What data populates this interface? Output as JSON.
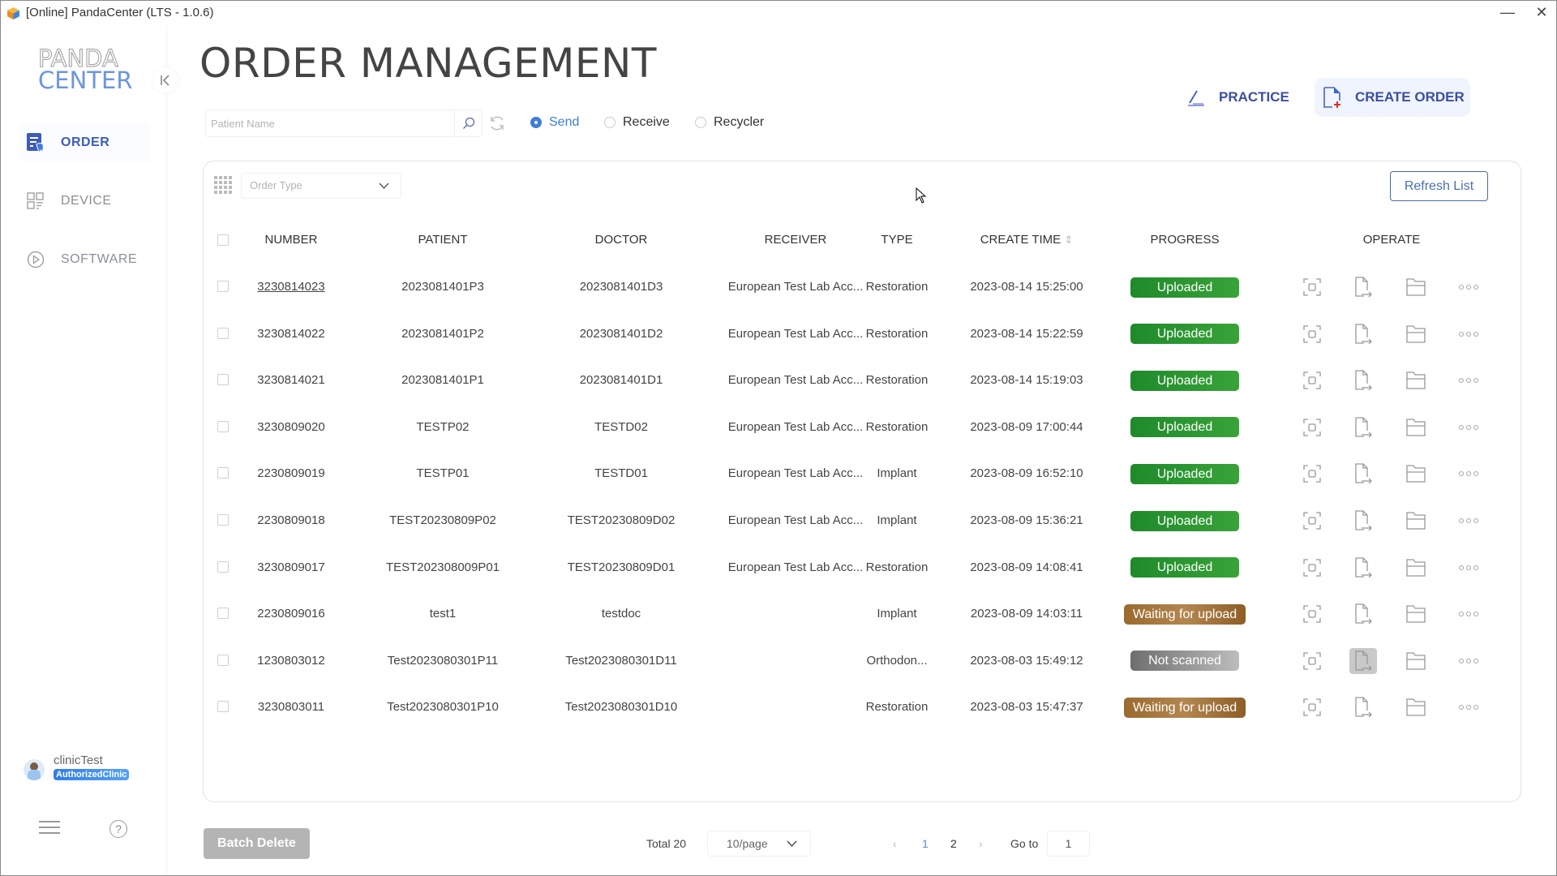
{
  "window": {
    "title": "[Online] PandaCenter (LTS - 1.0.6)",
    "minimize_glyph": "—",
    "close_glyph": "✕"
  },
  "sidebar": {
    "logo_top": "PANDA",
    "logo_bottom": "CENTER",
    "collapse_glyph": "|<",
    "items": [
      {
        "label": "ORDER",
        "icon": "order-tooth-icon",
        "active": true
      },
      {
        "label": "DEVICE",
        "icon": "device-grid-icon",
        "active": false
      },
      {
        "label": "SOFTWARE",
        "icon": "play-circle-icon",
        "active": false
      }
    ],
    "user": {
      "name": "clinicTest",
      "badge": "AuthorizedClinic"
    },
    "help_glyph": "?"
  },
  "header": {
    "title": "ORDER MANAGEMENT",
    "practice_label": "PRACTICE",
    "create_order_label": "CREATE ORDER"
  },
  "filters": {
    "search_placeholder": "Patient Name",
    "search_value": "",
    "radios": [
      {
        "label": "Send",
        "checked": true
      },
      {
        "label": "Receive",
        "checked": false
      },
      {
        "label": "Recycler",
        "checked": false
      }
    ],
    "order_type_placeholder": "Order Type",
    "refresh_label": "Refresh List"
  },
  "table": {
    "columns": [
      "NUMBER",
      "PATIENT",
      "DOCTOR",
      "RECEIVER",
      "TYPE",
      "CREATE TIME",
      "PROGRESS",
      "OPERATE"
    ],
    "sort_glyph": "⇕",
    "rows": [
      {
        "number": "3230814023",
        "patient": "2023081401P3",
        "doctor": "2023081401D3",
        "receiver": "European Test Lab Acc...",
        "type": "Restoration",
        "create_time": "2023-08-14 15:25:00",
        "progress": "Uploaded",
        "status": "uploaded"
      },
      {
        "number": "3230814022",
        "patient": "2023081401P2",
        "doctor": "2023081401D2",
        "receiver": "European Test Lab Acc...",
        "type": "Restoration",
        "create_time": "2023-08-14 15:22:59",
        "progress": "Uploaded",
        "status": "uploaded"
      },
      {
        "number": "3230814021",
        "patient": "2023081401P1",
        "doctor": "2023081401D1",
        "receiver": "European Test Lab Acc...",
        "type": "Restoration",
        "create_time": "2023-08-14 15:19:03",
        "progress": "Uploaded",
        "status": "uploaded"
      },
      {
        "number": "3230809020",
        "patient": "TESTP02",
        "doctor": "TESTD02",
        "receiver": "European Test Lab Acc...",
        "type": "Restoration",
        "create_time": "2023-08-09 17:00:44",
        "progress": "Uploaded",
        "status": "uploaded"
      },
      {
        "number": "2230809019",
        "patient": "TESTP01",
        "doctor": "TESTD01",
        "receiver": "European Test Lab Acc...",
        "type": "Implant",
        "create_time": "2023-08-09 16:52:10",
        "progress": "Uploaded",
        "status": "uploaded"
      },
      {
        "number": "2230809018",
        "patient": "TEST20230809P02",
        "doctor": "TEST20230809D02",
        "receiver": "European Test Lab Acc...",
        "type": "Implant",
        "create_time": "2023-08-09 15:36:21",
        "progress": "Uploaded",
        "status": "uploaded"
      },
      {
        "number": "3230809017",
        "patient": "TEST202308009P01",
        "doctor": "TEST20230809D01",
        "receiver": "European Test Lab Acc...",
        "type": "Restoration",
        "create_time": "2023-08-09 14:08:41",
        "progress": "Uploaded",
        "status": "uploaded"
      },
      {
        "number": "2230809016",
        "patient": "test1",
        "doctor": "testdoc",
        "receiver": "",
        "type": "Implant",
        "create_time": "2023-08-09 14:03:11",
        "progress": "Waiting for upload",
        "status": "waiting"
      },
      {
        "number": "1230803012",
        "patient": "Test2023080301P11",
        "doctor": "Test2023080301D11",
        "receiver": "",
        "type": "Orthodon...",
        "create_time": "2023-08-03 15:49:12",
        "progress": "Not scanned",
        "status": "notscanned"
      },
      {
        "number": "3230803011",
        "patient": "Test2023080301P10",
        "doctor": "Test2023080301D10",
        "receiver": "",
        "type": "Restoration",
        "create_time": "2023-08-03 15:47:37",
        "progress": "Waiting for upload",
        "status": "waiting"
      }
    ],
    "operate_icons": [
      "scan-icon",
      "export-file-icon",
      "folder-icon",
      "more-icon"
    ]
  },
  "footer": {
    "batch_delete_label": "Batch Delete",
    "total_label": "Total 20",
    "page_size": "10/page",
    "pages": [
      "1",
      "2"
    ],
    "current_page": "1",
    "prev_glyph": "‹",
    "next_glyph": "›",
    "goto_label": "Go to",
    "goto_value": "1"
  },
  "colors": {
    "accent": "#3e7ed6",
    "nav_active": "#3d5bb9",
    "uploaded": "#2a962f",
    "waiting": "#a57840",
    "not_scanned": "#8f8f8f"
  }
}
